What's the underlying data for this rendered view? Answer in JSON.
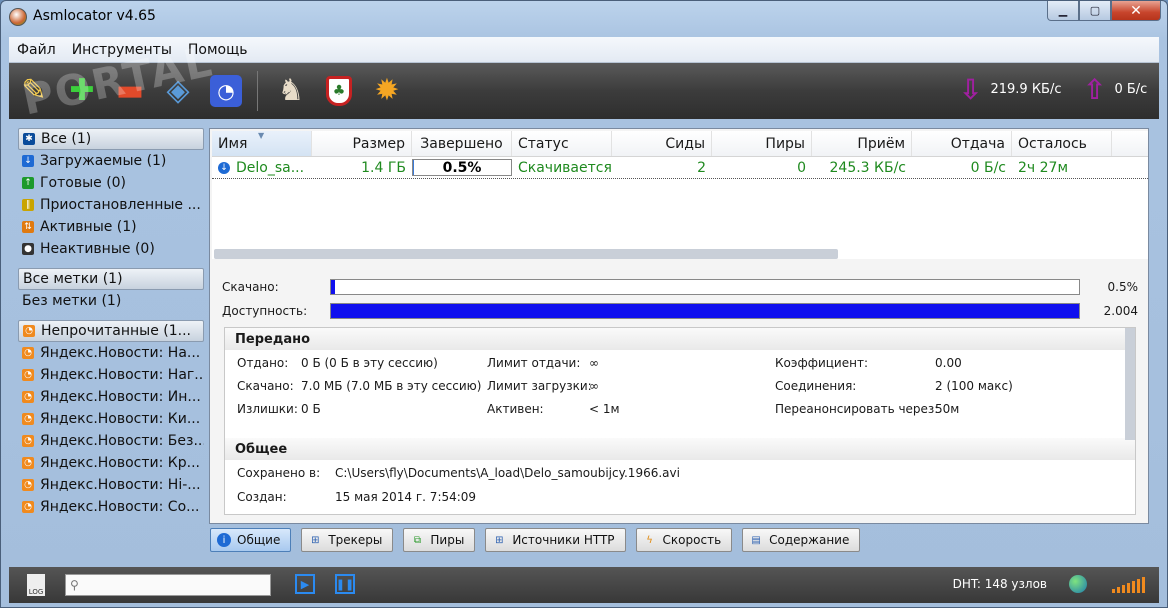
{
  "window": {
    "title": "Asmlocator v4.65"
  },
  "watermark": "PORTAL",
  "menu": [
    "Файл",
    "Инструменты",
    "Помощь"
  ],
  "speeds": {
    "download": "219.9 КБ/с",
    "upload": "0 Б/с"
  },
  "sidebar": {
    "filters": [
      {
        "label": "Все (1)",
        "icon": "all"
      },
      {
        "label": "Загружаемые (1)",
        "icon": "down"
      },
      {
        "label": "Готовые (0)",
        "icon": "done"
      },
      {
        "label": "Приостановленные ...",
        "icon": "pause"
      },
      {
        "label": "Активные (1)",
        "icon": "active"
      },
      {
        "label": "Неактивные (0)",
        "icon": "inactive"
      }
    ],
    "labels": [
      "Все метки (1)",
      "Без метки (1)"
    ],
    "feeds": [
      "Непрочитанные (1...",
      "Яндекс.Новости: На...",
      "Яндекс.Новости: Наг...",
      "Яндекс.Новости: Ин...",
      "Яндекс.Новости: Ки...",
      "Яндекс.Новости: Без...",
      "Яндекс.Новости: Кр...",
      "Яндекс.Новости: Hi-...",
      "Яндекс.Новости: Со..."
    ]
  },
  "list": {
    "columns": [
      "Имя",
      "Размер",
      "Завершено",
      "Статус",
      "Сиды",
      "Пиры",
      "Приём",
      "Отдача",
      "Осталось"
    ],
    "row": {
      "name": "Delo_sa...",
      "size": "1.4 ГБ",
      "done": "0.5%",
      "done_fraction": 0.005,
      "status": "Скачивается",
      "seeds": "2",
      "peers": "0",
      "down": "245.3 КБ/с",
      "up": "0 Б/с",
      "eta": "2ч 27м"
    }
  },
  "detail": {
    "downloaded_label": "Скачано:",
    "downloaded_value": "0.5%",
    "downloaded_fraction": 0.005,
    "availability_label": "Доступность:",
    "availability_value": "2.004",
    "availability_fraction": 1.0,
    "transfer": {
      "title": "Передано",
      "uploaded_label": "Отдано:",
      "uploaded_value": "0 Б (0 Б в эту сессию)",
      "downloaded_label": "Скачано:",
      "downloaded_value": "7.0 МБ (7.0 МБ в эту сессию)",
      "waste_label": "Излишки:",
      "waste_value": "0 Б",
      "ul_limit_label": "Лимит отдачи:",
      "ul_limit_value": "∞",
      "dl_limit_label": "Лимит загрузки:",
      "dl_limit_value": "∞",
      "active_label": "Активен:",
      "active_value": "< 1м",
      "ratio_label": "Коэффициент:",
      "ratio_value": "0.00",
      "conn_label": "Соединения:",
      "conn_value": "2 (100 макс)",
      "reannounce_label": "Переанонсировать через:",
      "reannounce_value": "50м"
    },
    "general": {
      "title": "Общее",
      "saved_label": "Сохранено в:",
      "saved_value": "C:\\Users\\fly\\Documents\\A_load\\Delo_samoubijcy.1966.avi",
      "created_label": "Создан:",
      "created_value": "15 мая 2014 г. 7:54:09"
    }
  },
  "tabs": [
    "Общие",
    "Трекеры",
    "Пиры",
    "Источники HTTP",
    "Скорость",
    "Содержание"
  ],
  "status": {
    "dht": "DHT: 148 узлов",
    "log_label": "LOG"
  }
}
